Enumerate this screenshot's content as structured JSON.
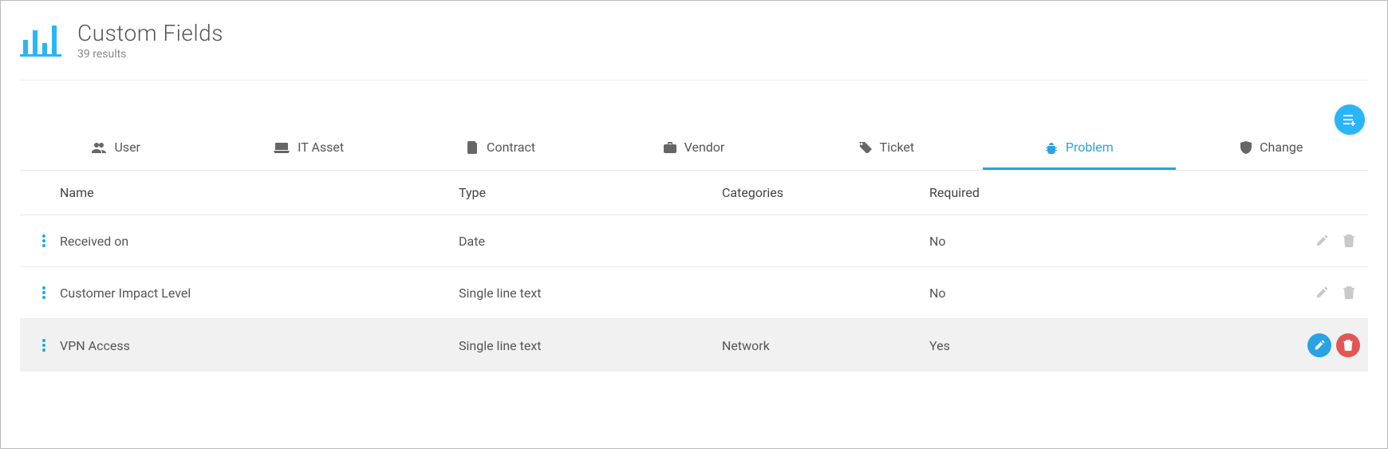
{
  "header": {
    "title": "Custom Fields",
    "subtitle": "39 results"
  },
  "tabs": [
    {
      "id": "user",
      "label": "User",
      "active": false
    },
    {
      "id": "itasset",
      "label": "IT Asset",
      "active": false
    },
    {
      "id": "contract",
      "label": "Contract",
      "active": false
    },
    {
      "id": "vendor",
      "label": "Vendor",
      "active": false
    },
    {
      "id": "ticket",
      "label": "Ticket",
      "active": false
    },
    {
      "id": "problem",
      "label": "Problem",
      "active": true
    },
    {
      "id": "change",
      "label": "Change",
      "active": false
    }
  ],
  "columns": {
    "name": "Name",
    "type": "Type",
    "categories": "Categories",
    "required": "Required"
  },
  "rows": [
    {
      "name": "Received on",
      "type": "Date",
      "categories": "",
      "required": "No",
      "hover": false
    },
    {
      "name": "Customer Impact Level",
      "type": "Single line text",
      "categories": "",
      "required": "No",
      "hover": false
    },
    {
      "name": "VPN Access",
      "type": "Single line text",
      "categories": "Network",
      "required": "Yes",
      "hover": true
    }
  ],
  "colors": {
    "accent": "#29a3e2",
    "fab": "#29b6f6",
    "danger": "#e25656",
    "muted": "#c9c9c9"
  }
}
